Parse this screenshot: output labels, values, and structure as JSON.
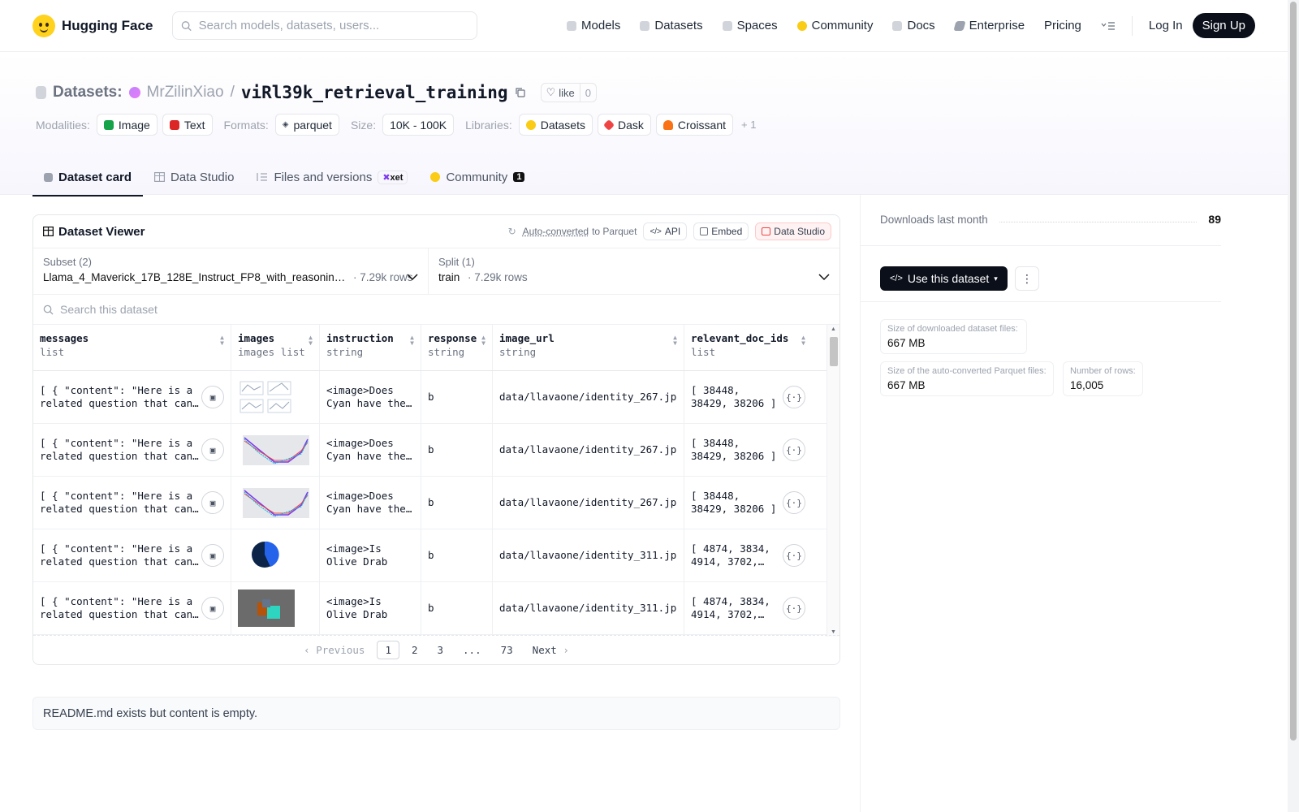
{
  "nav": {
    "brand": "Hugging Face",
    "search_placeholder": "Search models, datasets, users...",
    "links": [
      {
        "label": "Models",
        "icon": "cube-icon",
        "color": "#9ca3af"
      },
      {
        "label": "Datasets",
        "icon": "database-icon",
        "color": "#9ca3af"
      },
      {
        "label": "Spaces",
        "icon": "grid-icon",
        "color": "#9ca3af"
      },
      {
        "label": "Community",
        "icon": "community-icon",
        "color": "#facc15"
      },
      {
        "label": "Docs",
        "icon": "book-icon",
        "color": "#9ca3af"
      },
      {
        "label": "Enterprise",
        "icon": "enterprise-icon",
        "color": "#9ca3af"
      }
    ],
    "pricing": "Pricing",
    "login": "Log In",
    "signup": "Sign Up"
  },
  "header": {
    "crumb": "Datasets:",
    "owner": "MrZilinXiao",
    "slash": "/",
    "name": "viRl39k_retrieval_training",
    "like_label": "like",
    "like_count": "0",
    "modalities_label": "Modalities:",
    "modalities": [
      {
        "label": "Image",
        "color": "#16a34a"
      },
      {
        "label": "Text",
        "color": "#dc2626"
      }
    ],
    "formats_label": "Formats:",
    "format": "parquet",
    "size_label": "Size:",
    "size": "10K - 100K",
    "libraries_label": "Libraries:",
    "libraries": [
      {
        "label": "Datasets",
        "color": "#facc15"
      },
      {
        "label": "Dask",
        "color": "#ef4444"
      },
      {
        "label": "Croissant",
        "color": "#f97316"
      }
    ],
    "more": "+ 1"
  },
  "tabs": [
    {
      "label": "Dataset card"
    },
    {
      "label": "Data Studio"
    },
    {
      "label": "Files and versions",
      "badge": "xet"
    },
    {
      "label": "Community",
      "badge": "1"
    }
  ],
  "viewer": {
    "title": "Dataset Viewer",
    "auto_converted": "Auto-converted",
    "to_parquet": "to Parquet",
    "api": "API",
    "embed": "Embed",
    "data_studio": "Data Studio",
    "subset_label": "Subset (2)",
    "subset_value": "Llama_4_Maverick_17B_128E_Instruct_FP8_with_reasonin…",
    "subset_rows": "7.29k rows",
    "split_label": "Split (1)",
    "split_value": "train",
    "split_rows": "7.29k rows",
    "search_placeholder": "Search this dataset",
    "columns": [
      {
        "name": "messages",
        "type": "list"
      },
      {
        "name": "images",
        "type": "images list"
      },
      {
        "name": "instruction",
        "type": "string"
      },
      {
        "name": "response",
        "type": "string"
      },
      {
        "name": "image_url",
        "type": "string"
      },
      {
        "name": "relevant_doc_ids",
        "type": "list"
      }
    ],
    "rows": [
      {
        "messages": "[ { \"content\": \"Here is a related question that can…",
        "image": "grid-plot",
        "instruction": "<image>Does Cyan have the…",
        "response": "b",
        "image_url": "data/llavaone/identity_267.jpg",
        "doc_ids": "[ 38448, 38429, 38206 ]"
      },
      {
        "messages": "[ { \"content\": \"Here is a related question that can…",
        "image": "line-chart",
        "instruction": "<image>Does Cyan have the…",
        "response": "b",
        "image_url": "data/llavaone/identity_267.jpg",
        "doc_ids": "[ 38448, 38429, 38206 ]"
      },
      {
        "messages": "[ { \"content\": \"Here is a related question that can…",
        "image": "line-chart",
        "instruction": "<image>Does Cyan have the…",
        "response": "b",
        "image_url": "data/llavaone/identity_267.jpg",
        "doc_ids": "[ 38448, 38429, 38206 ]"
      },
      {
        "messages": "[ { \"content\": \"Here is a related question that can…",
        "image": "pie-chart",
        "instruction": "<image>Is Olive Drab the…",
        "response": "b",
        "image_url": "data/llavaone/identity_311.jpg",
        "doc_ids": "[ 4874, 3834, 4914, 3702,…"
      },
      {
        "messages": "[ { \"content\": \"Here is a related question that can…",
        "image": "3d-render",
        "instruction": "<image>Is Olive Drab the…",
        "response": "b",
        "image_url": "data/llavaone/identity_311.jpg",
        "doc_ids": "[ 4874, 3834, 4914, 3702,…"
      }
    ],
    "pager": {
      "previous": "Previous",
      "pages": [
        "1",
        "2",
        "3",
        "...",
        "73"
      ],
      "next": "Next"
    }
  },
  "readme_text": "README.md exists but content is empty.",
  "sidebar": {
    "downloads_label": "Downloads last month",
    "downloads_value": "89",
    "use_button": "Use this dataset",
    "stats": [
      {
        "label": "Size of downloaded dataset files:",
        "value": "667 MB"
      },
      {
        "label": "Size of the auto-converted Parquet files:",
        "value": "667 MB"
      },
      {
        "label": "Number of rows:",
        "value": "16,005"
      }
    ]
  }
}
